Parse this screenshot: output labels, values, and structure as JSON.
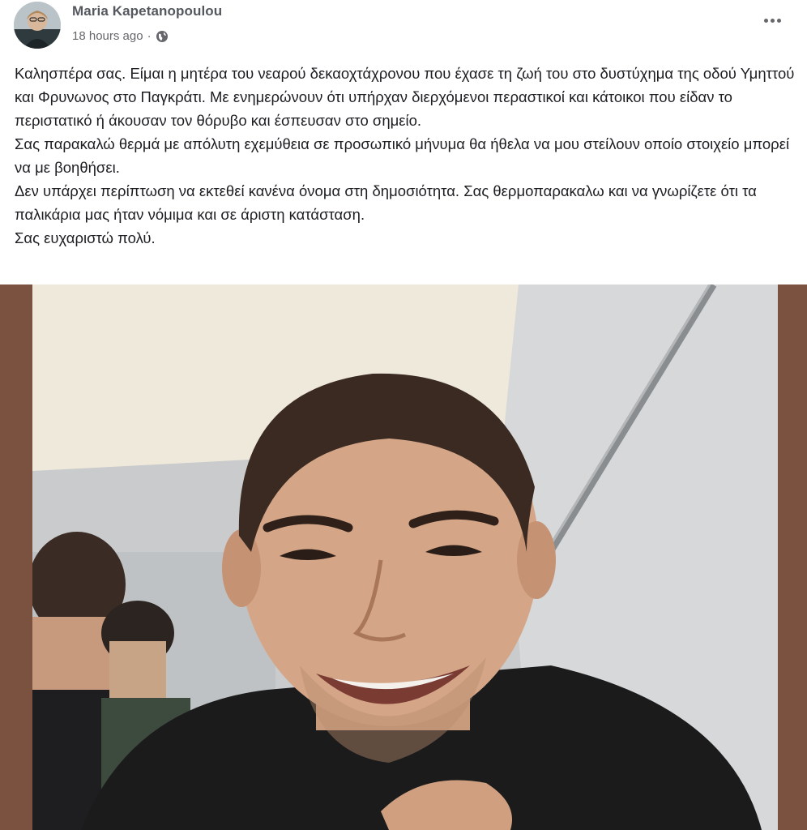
{
  "post": {
    "author_name": "Maria Kapetanopoulou",
    "timestamp": "18 hours ago",
    "separator": "·",
    "audience_icon": "globe-icon",
    "more_icon": "more-options-icon",
    "body_paragraphs": [
      "Καλησπέρα σας. Είμαι η μητέρα του νεαρού δεκαοχτάχρονου που έχασε τη ζωή του στο δυστύχημα της οδού Υμηττού και Φρυνωνος στο Παγκράτι. Με ενημερώνουν ότι υπήρχαν διερχόμενοι περαστικοί και κάτοικοι που είδαν το περιστατικό ή άκουσαν τον θόρυβο και έσπευσαν στο σημείο.",
      "Σας παρακαλώ θερμά με απόλυτη εχεμύθεια σε προσωπικό μήνυμα θα ήθελα να μου στείλουν οποίο στοιχείο μπορεί να με βοηθήσει.",
      "Δεν υπάρχει περίπτωση να εκτεθεί κανένα όνομα στη δημοσιότητα. Σας θερμοπαρακαλω και να γνωρίζετε ότι τα παλικάρια μας ήταν νόμιμα και σε άριστη κατάσταση.",
      "Σας ευχαριστώ πολύ."
    ]
  },
  "colors": {
    "frame_brown": "#7b5140",
    "author_gray": "#54585e",
    "meta_gray": "#65676b",
    "text_dark": "#1c1e21"
  }
}
